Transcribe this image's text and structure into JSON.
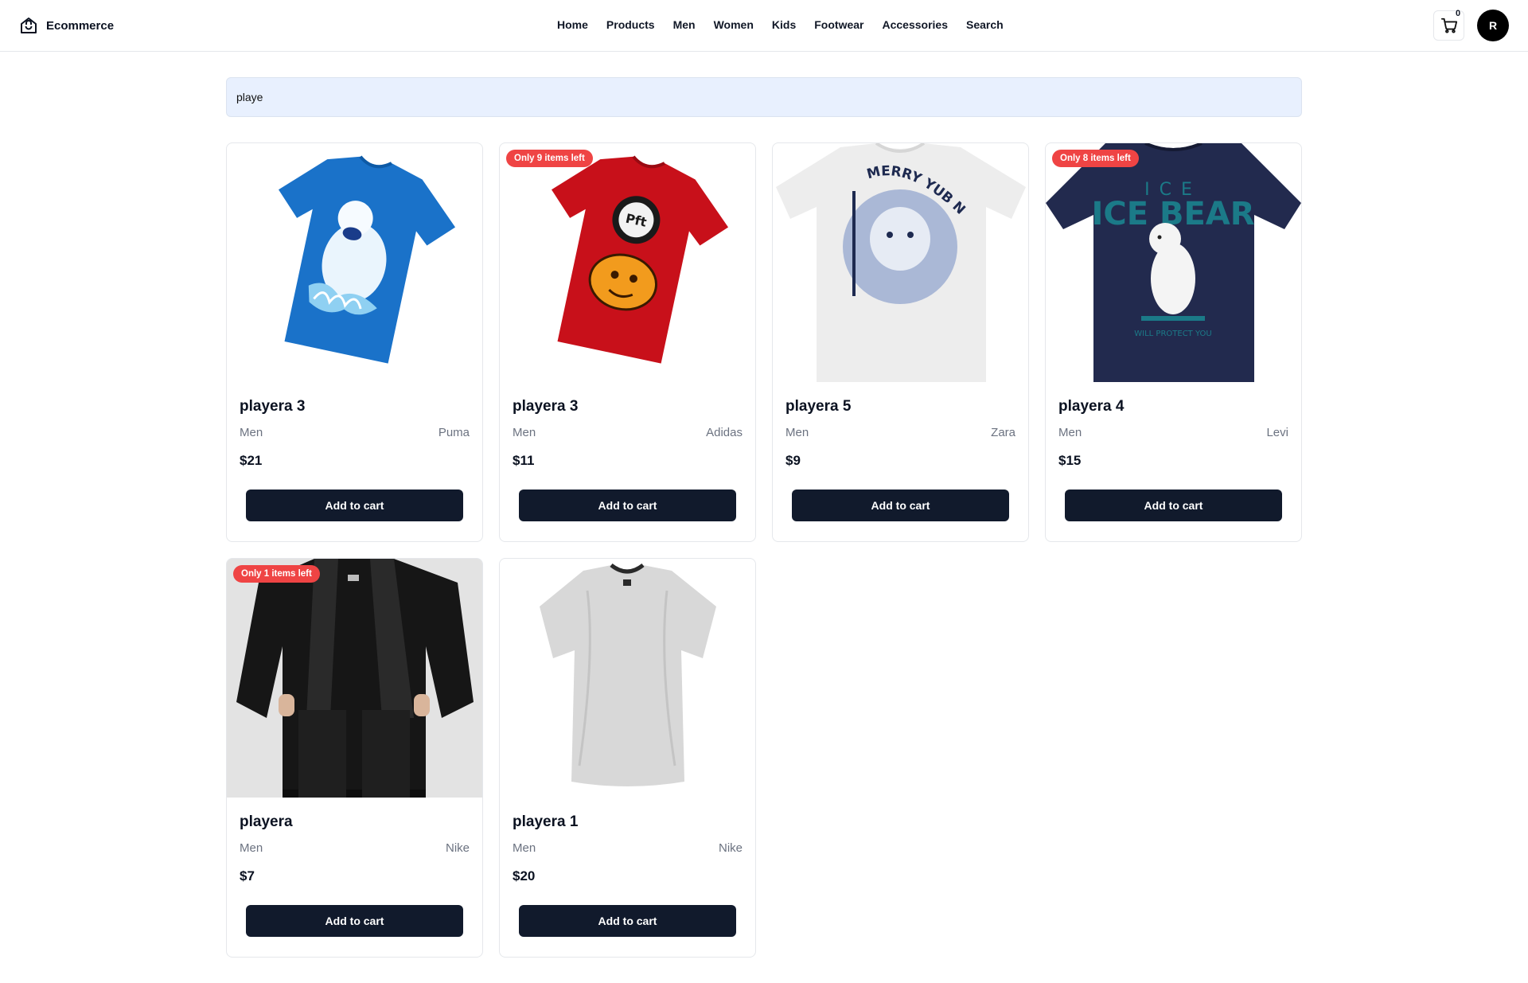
{
  "header": {
    "brand": "Ecommerce",
    "nav": [
      "Home",
      "Products",
      "Men",
      "Women",
      "Kids",
      "Footwear",
      "Accessories",
      "Search"
    ],
    "cart_count": "0",
    "avatar_initial": "R"
  },
  "search": {
    "value": "playe"
  },
  "products": [
    {
      "title": "playera 3",
      "category": "Men",
      "brand": "Puma",
      "price": "$21",
      "button": "Add to cart",
      "badge": "",
      "image_icon": "blue-tshirt-polar-bear",
      "bg_color": "#ffffff"
    },
    {
      "title": "playera 3",
      "category": "Men",
      "brand": "Adidas",
      "price": "$11",
      "button": "Add to cart",
      "badge": "Only 9 items left",
      "image_icon": "red-tshirt-cartoon",
      "bg_color": "#ffffff"
    },
    {
      "title": "playera 5",
      "category": "Men",
      "brand": "Zara",
      "price": "$9",
      "button": "Add to cart",
      "badge": "",
      "image_icon": "white-tshirt-ewok-print",
      "print_text": "MERRY YUB NUB",
      "bg_color": "#ffffff"
    },
    {
      "title": "playera 4",
      "category": "Men",
      "brand": "Levi",
      "price": "$15",
      "button": "Add to cart",
      "badge": "Only 8 items left",
      "image_icon": "navy-tshirt-ice-bear",
      "print_text": "ICE BEAR",
      "print_subtext": "WILL PROTECT YOU",
      "bg_color": "#ffffff"
    },
    {
      "title": "playera",
      "category": "Men",
      "brand": "Nike",
      "price": "$7",
      "button": "Add to cart",
      "badge": "Only 1 items left",
      "image_icon": "model-black-outfit",
      "bg_color": "#e8e8e8"
    },
    {
      "title": "playera 1",
      "category": "Men",
      "brand": "Nike",
      "price": "$20",
      "button": "Add to cart",
      "badge": "",
      "image_icon": "white-tshirt-plain",
      "bg_color": "#ffffff"
    }
  ],
  "colors": {
    "badge": "#ef4444",
    "button": "#111a2c",
    "search_bg": "#e8f0fe"
  }
}
